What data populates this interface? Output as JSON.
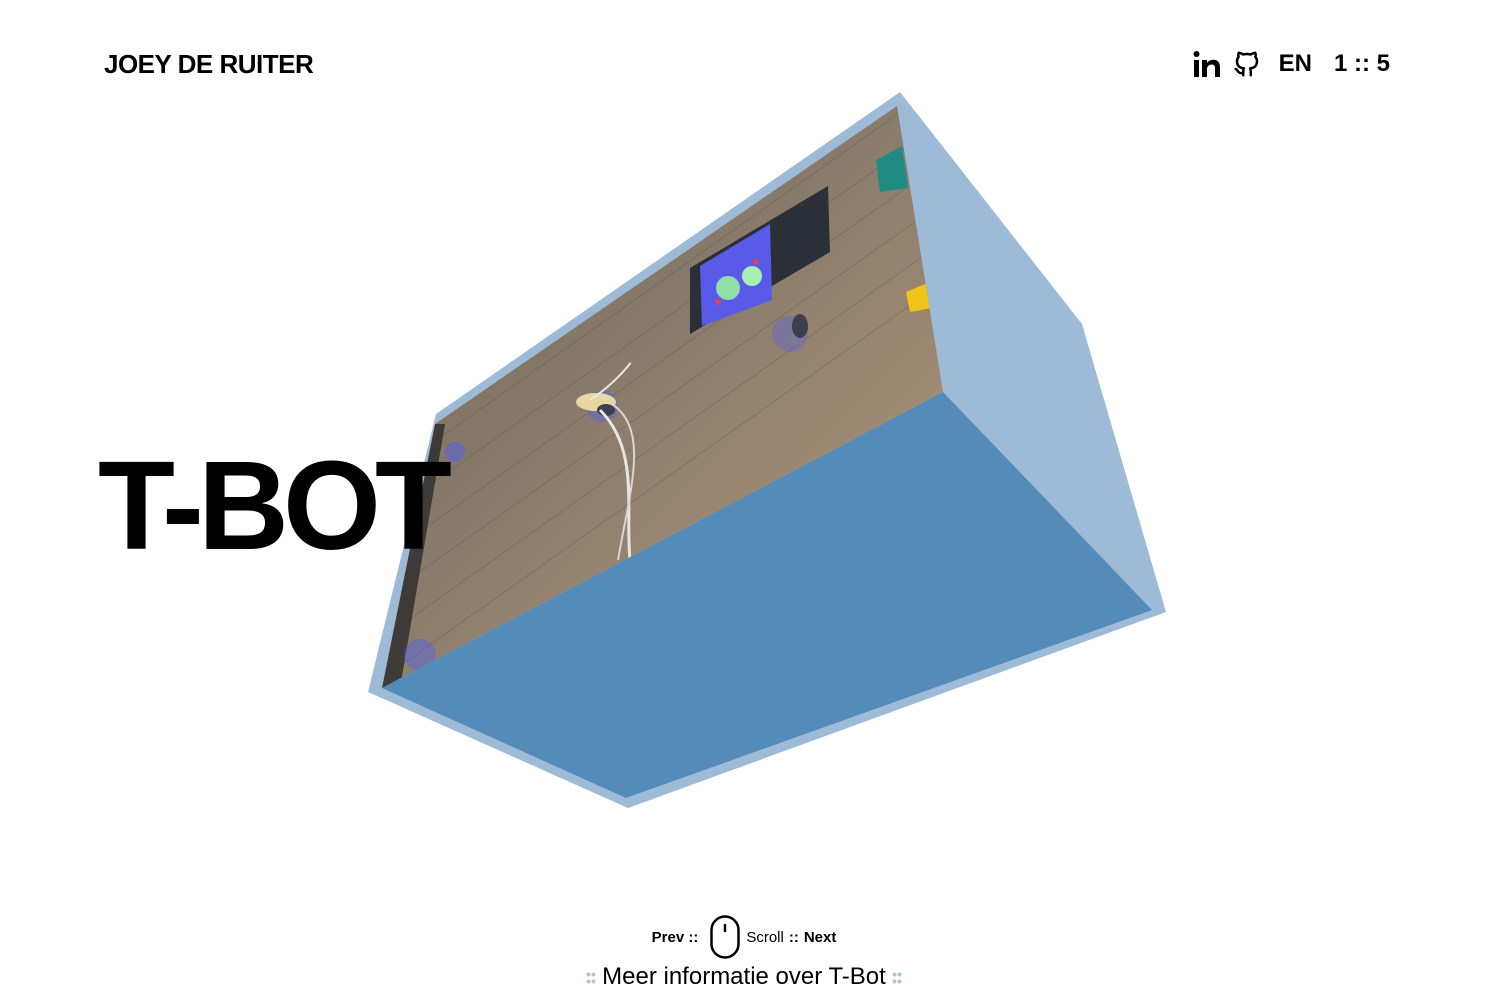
{
  "header": {
    "brand": "JOEY DE RUITER",
    "icons": [
      "linkedin-icon",
      "github-icon"
    ],
    "language": "EN",
    "counter": "1 :: 5"
  },
  "project": {
    "title": "T-BOT"
  },
  "nav": {
    "prev_label": "Prev ::",
    "scroll_label": "Scroll",
    "next_sep": "::",
    "next_label": "Next"
  },
  "more_info": {
    "label": "Meer informatie over T-Bot"
  },
  "colors": {
    "box_front": "#548bb9",
    "box_side": "#9dbbd6",
    "dots": "#a9c4dc",
    "text": "#000000"
  }
}
